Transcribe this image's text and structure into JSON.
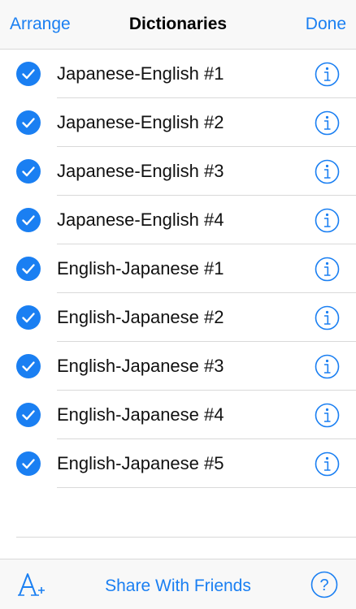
{
  "nav": {
    "left_label": "Arrange",
    "title": "Dictionaries",
    "right_label": "Done"
  },
  "dictionaries": [
    {
      "label": "Japanese-English #1",
      "checked": true
    },
    {
      "label": "Japanese-English #2",
      "checked": true
    },
    {
      "label": "Japanese-English #3",
      "checked": true
    },
    {
      "label": "Japanese-English #4",
      "checked": true
    },
    {
      "label": "English-Japanese #1",
      "checked": true
    },
    {
      "label": "English-Japanese #2",
      "checked": true
    },
    {
      "label": "English-Japanese #3",
      "checked": true
    },
    {
      "label": "English-Japanese #4",
      "checked": true
    },
    {
      "label": "English-Japanese #5",
      "checked": true
    }
  ],
  "toolbar": {
    "font_icon": "font-size-icon",
    "share_label": "Share With Friends",
    "help_icon": "help-icon"
  },
  "colors": {
    "accent": "#1a7ff2",
    "bar_background": "#f8f8f8",
    "separator": "#d9d9d9"
  }
}
